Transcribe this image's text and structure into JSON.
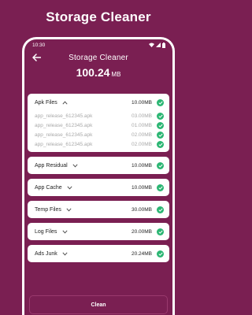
{
  "headline": "Storage Cleaner",
  "status_bar": {
    "time": "10:30"
  },
  "app_bar": {
    "title": "Storage Cleaner"
  },
  "total": {
    "value": "100.24",
    "unit": "MB"
  },
  "categories": [
    {
      "name": "Apk Files",
      "size": "10.00MB",
      "expanded": true,
      "files": [
        {
          "name": "app_release_612345.apk",
          "size": "03.00MB"
        },
        {
          "name": "app_release_612345.apk",
          "size": "01.00MB"
        },
        {
          "name": "app_release_612345.apk",
          "size": "02.00MB"
        },
        {
          "name": "app_release_612345.apk",
          "size": "02.00MB"
        }
      ]
    },
    {
      "name": "App Residual",
      "size": "10.00MB",
      "expanded": false
    },
    {
      "name": "App Cache",
      "size": "10.00MB",
      "expanded": false
    },
    {
      "name": "Temp Files",
      "size": "30.00MB",
      "expanded": false
    },
    {
      "name": "Log Files",
      "size": "20.00MB",
      "expanded": false
    },
    {
      "name": "Ads Junk",
      "size": "20.24MB",
      "expanded": false
    }
  ],
  "clean_button": "Clean",
  "icons": {
    "back": "arrow-left-icon",
    "expand": "chevron-down-icon",
    "collapse": "chevron-up-icon",
    "selected": "check-circle-icon",
    "wifi": "wifi-icon",
    "signal": "signal-icon",
    "battery": "battery-icon"
  },
  "colors": {
    "primary": "#7a1f52",
    "check": "#2bb673",
    "card": "#ffffff"
  }
}
